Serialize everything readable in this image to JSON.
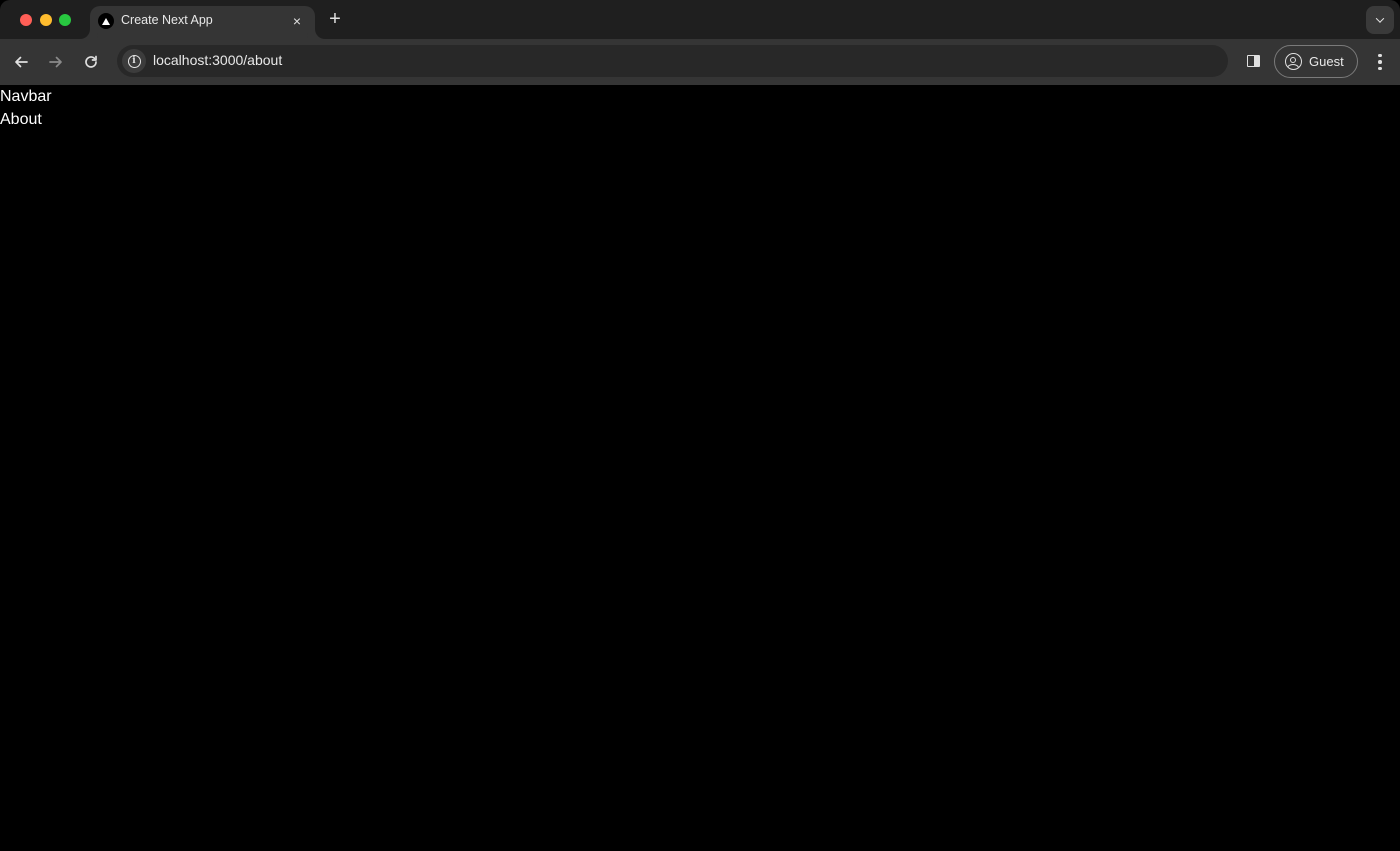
{
  "browser": {
    "tabs": [
      {
        "title": "Create Next App",
        "favicon": "nextjs-triangle-icon",
        "active": true
      }
    ],
    "new_tab_symbol": "+",
    "close_symbol": "×",
    "address": {
      "url": "localhost:3000/about",
      "site_info_icon": "info-icon"
    },
    "profile": {
      "label": "Guest",
      "icon": "account-circle-icon"
    },
    "colors": {
      "tabstrip": "#1f1f1f",
      "toolbar": "#353535",
      "omnibox": "#282828",
      "close": "#ff5f57",
      "minimize": "#febc2e",
      "maximize": "#28c840"
    }
  },
  "page": {
    "background": "#000000",
    "lines": [
      "Navbar",
      "About"
    ]
  }
}
